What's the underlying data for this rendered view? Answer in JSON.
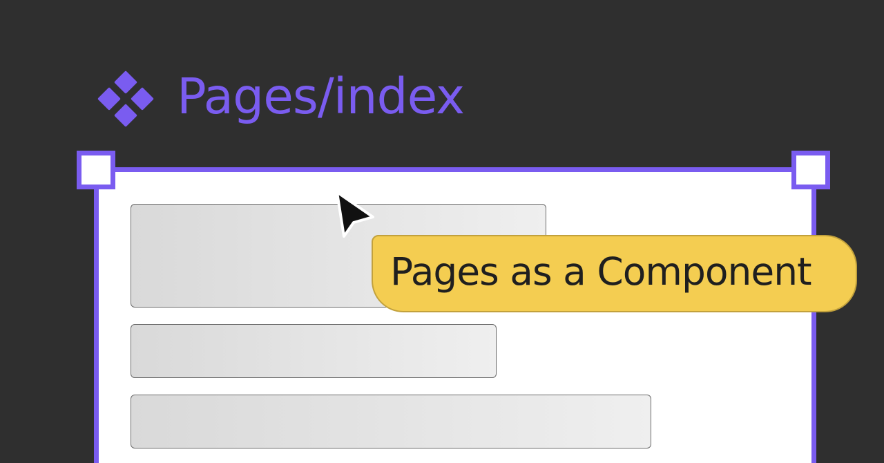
{
  "component": {
    "title": "Pages/index",
    "icon": "component-icon"
  },
  "tooltip": {
    "text": "Pages as a Component"
  },
  "cursor": {
    "icon": "cursor-arrow-icon"
  },
  "colors": {
    "background": "#2f2f2f",
    "accent": "#7a5cf0",
    "tooltip_fill": "#f4cd51",
    "tooltip_border": "#c2a13c",
    "frame_fill": "#ffffff",
    "placeholder_fill": "#e0e0e0"
  }
}
